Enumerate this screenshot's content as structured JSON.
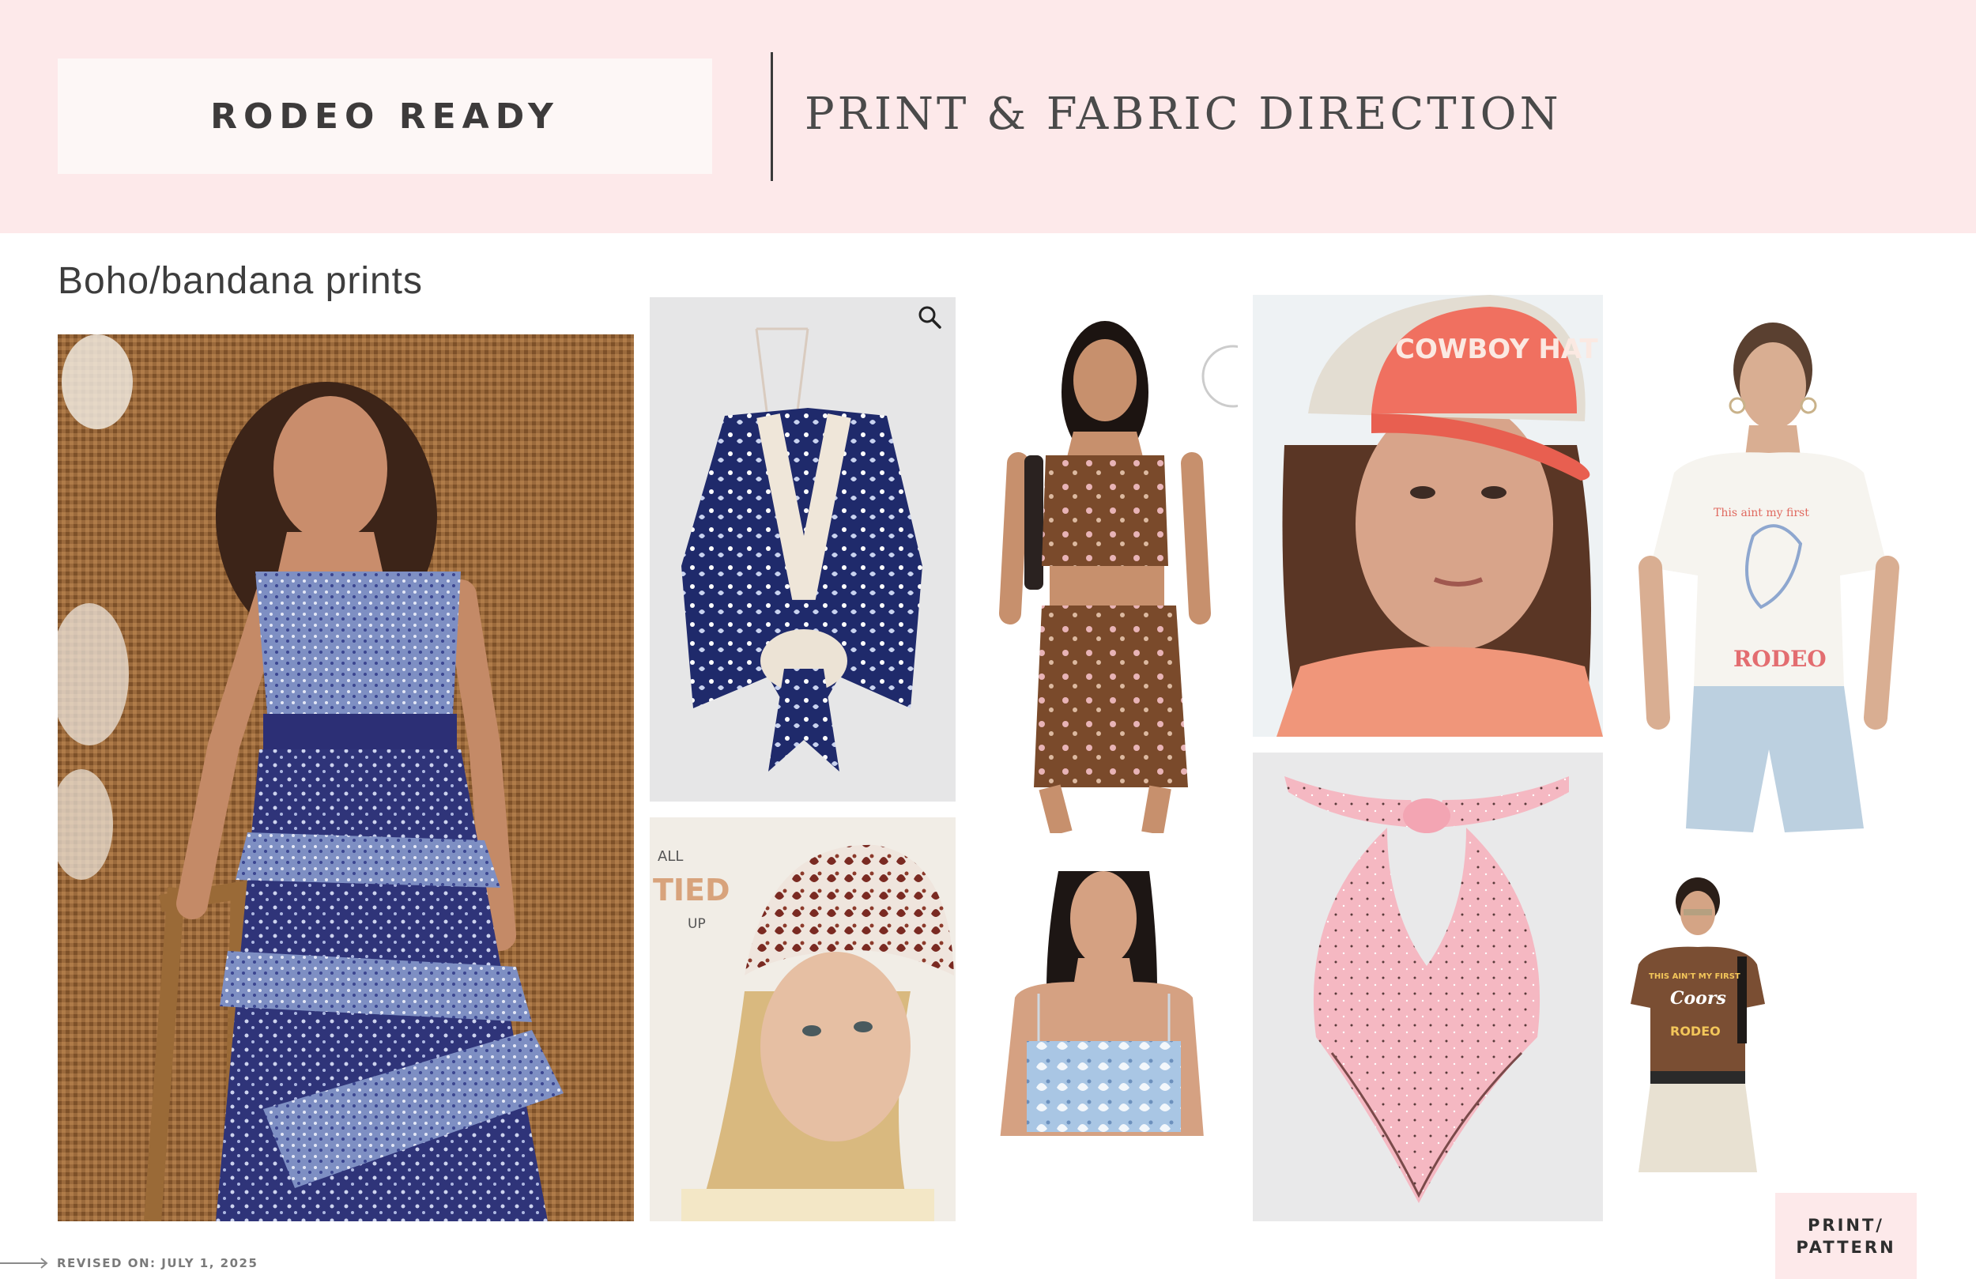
{
  "header": {
    "brand": "RODEO READY",
    "subtitle": "PRINT & FABRIC DIRECTION"
  },
  "section": {
    "title": "Boho/bandana prints"
  },
  "images": {
    "tied_text_1": "ALL",
    "tied_text_2": "TIED",
    "tied_text_3": "UP",
    "cap_text": "COWBOY HAT",
    "tee_text_1": "This aint my first",
    "tee_text_2": "RODEO",
    "tee2_text_1": "THIS AIN'T MY FIRST",
    "tee2_text_2": "Coors",
    "tee2_text_3": "RODEO"
  },
  "badge": {
    "line1": "PRINT/",
    "line2": "PATTERN"
  },
  "footer": {
    "revised": "REVISED ON: JULY 1, 2025"
  },
  "colors": {
    "header_bg": "#fde9ea",
    "brand_box": "#fdf7f6",
    "text_dark": "#3d3b3b"
  },
  "icons": [
    "zoom-icon",
    "arrow-right-icon"
  ]
}
